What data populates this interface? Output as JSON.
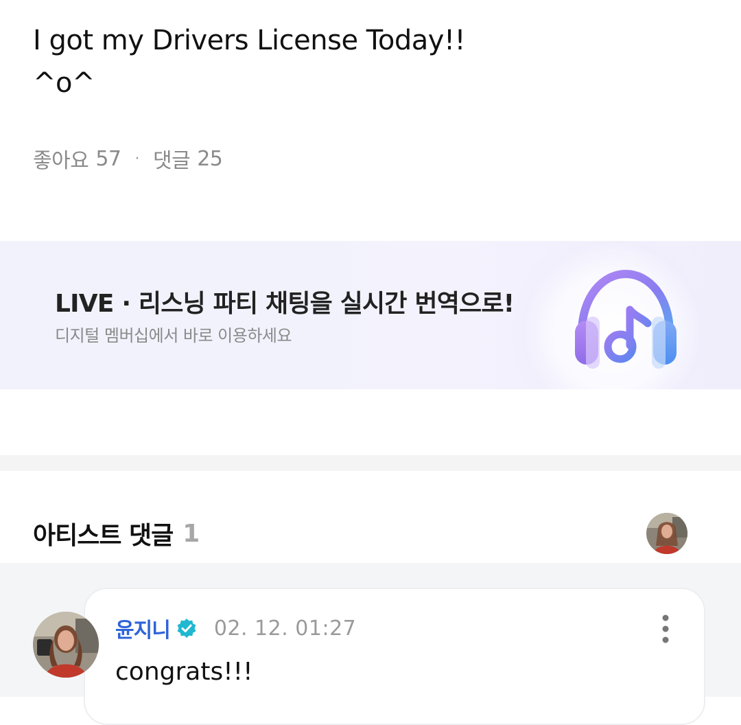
{
  "post": {
    "lines": [
      "I got my Drivers License Today!!",
      "^o^"
    ]
  },
  "stats": {
    "likes_label": "좋아요",
    "likes_count": "57",
    "separator": "·",
    "comments_label": "댓글",
    "comments_count": "25"
  },
  "banner": {
    "title": "LIVE · 리스닝 파티 채팅을 실시간 번역으로!",
    "subtitle": "디지털 멤버십에서 바로 이용하세요",
    "icon": "headphones-music-note-icon"
  },
  "artist_comments": {
    "title": "아티스트 댓글",
    "count": "1"
  },
  "comments": [
    {
      "author": "윤지니",
      "verified_icon": "verified-badge-icon",
      "time": "02. 12. 01:27",
      "text": "congrats!!!",
      "more_icon": "more-vertical-icon"
    }
  ],
  "colors": {
    "author_name": "#2f63d9",
    "verified_badge": "#1fb8d0",
    "banner_bg": "#f1f2fc",
    "muted_text": "#8a8a8a"
  }
}
